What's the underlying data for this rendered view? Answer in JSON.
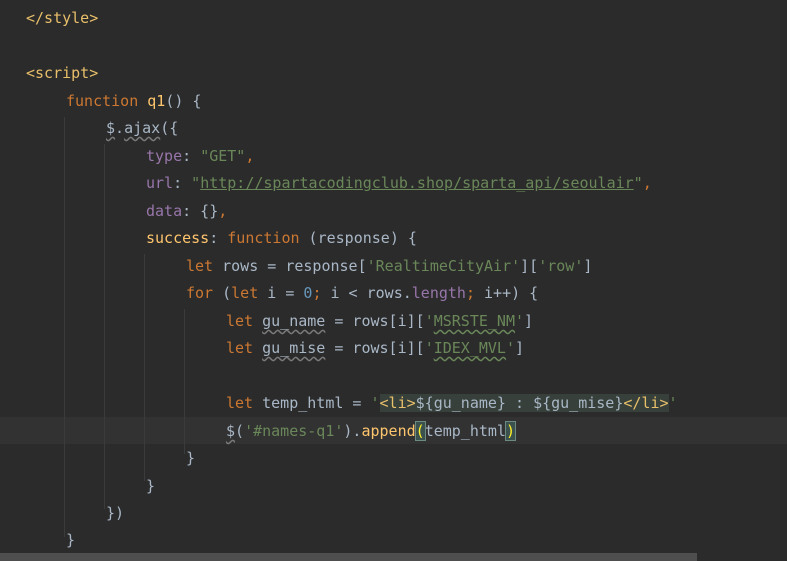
{
  "editor": {
    "lines": {
      "l1": {
        "close_style": "</style>"
      },
      "l3": {
        "open_script": "<script>"
      },
      "l4": {
        "function_kw": "function",
        "fn_name": "q1",
        "rest": "() {"
      },
      "l5": {
        "dollar": "$",
        "dot": ".",
        "ajax": "ajax",
        "rest": "({"
      },
      "l6": {
        "key": "type",
        "colon": ": ",
        "value": "\"GET\"",
        "comma": ","
      },
      "l7": {
        "key": "url",
        "colon": ": ",
        "quote_open": "\"",
        "url": "http://spartacodingclub.shop/sparta_api/seoulair",
        "quote_close": "\"",
        "comma": ","
      },
      "l8": {
        "key": "data",
        "rest": ": {}",
        "comma": ","
      },
      "l9": {
        "key": "success",
        "colon": ": ",
        "function_kw": "function",
        "rest": " (response) {"
      },
      "l10": {
        "let_kw": "let",
        "mid": " rows = response[",
        "s1": "'RealtimeCityAir'",
        "mid2": "][",
        "s2": "'row'",
        "end": "]"
      },
      "l11": {
        "for_kw": "for",
        "p1": " (",
        "let_kw": "let",
        "p2": " i = ",
        "zero": "0",
        "semi1": ";",
        "p3": " i < rows.",
        "length": "length",
        "semi2": ";",
        "p4": " i++) {"
      },
      "l12": {
        "let_kw": "let",
        "sp": " ",
        "var": "gu_name",
        "mid": " = rows[i][",
        "q1": "'",
        "s": "MSRSTE_NM",
        "q2": "'",
        "end": "]"
      },
      "l13": {
        "let_kw": "let",
        "sp": " ",
        "var": "gu_mise",
        "mid": " = rows[i][",
        "q1": "'",
        "s": "IDEX_MVL",
        "q2": "'",
        "end": "]"
      },
      "l15": {
        "let_kw": "let",
        "mid": " temp_html = ",
        "q1": "'",
        "li_open": "<li>",
        "tpl1": "${gu_name}",
        "colon": " : ",
        "tpl2": "${gu_mise}",
        "li_close": "</li>",
        "q2": "'"
      },
      "l16": {
        "dollar": "$",
        "p1": "(",
        "s": "'#names-q1'",
        "p2": ").",
        "append": "append",
        "paren_open": "(",
        "arg": "temp_html",
        "paren_close": ")"
      },
      "l17": {
        "text": "}"
      },
      "l18": {
        "text": "}"
      },
      "l19": {
        "text": "})"
      },
      "l20": {
        "text": "}"
      }
    }
  }
}
